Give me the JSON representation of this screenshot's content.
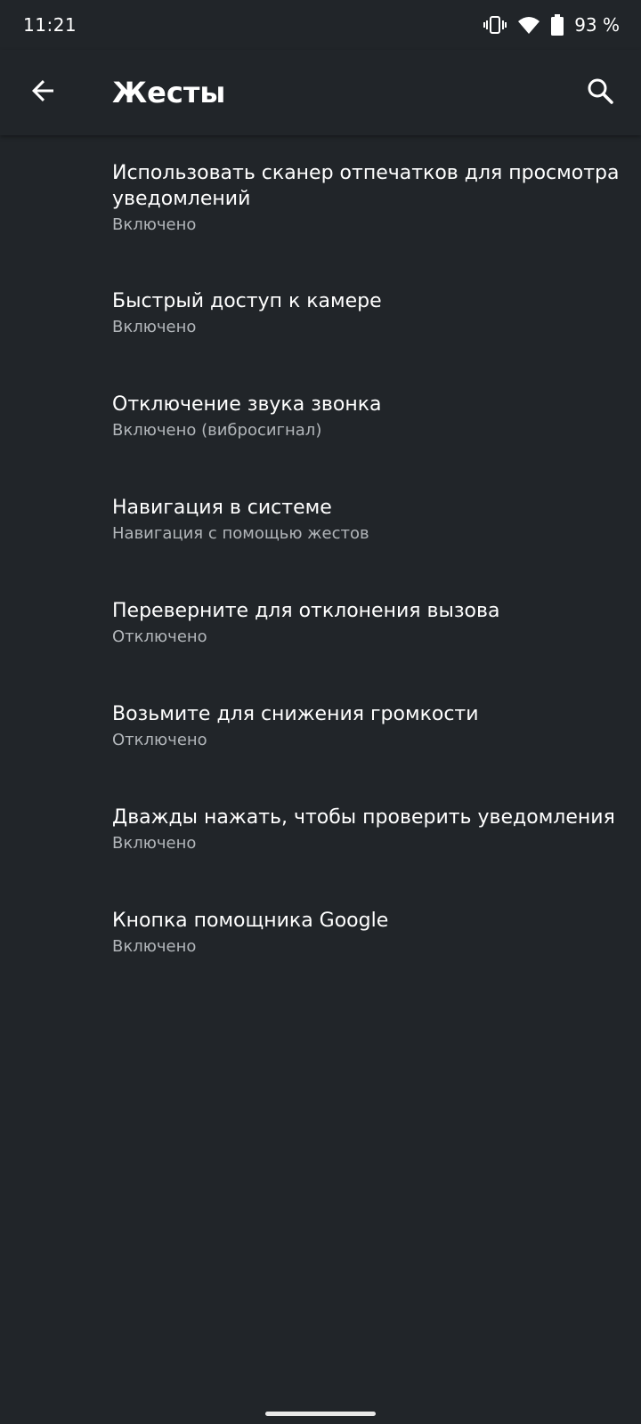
{
  "status_bar": {
    "time": "11:21",
    "battery_percent": "93 %",
    "icons": [
      "vibrate-icon",
      "wifi-icon",
      "battery-icon"
    ]
  },
  "app_bar": {
    "title": "Жесты",
    "back_icon": "arrow-back-icon",
    "search_icon": "search-icon"
  },
  "settings": [
    {
      "title": "Использовать сканер отпечатков для просмотра уведомлений",
      "summary": "Включено"
    },
    {
      "title": "Быстрый доступ к камере",
      "summary": "Включено"
    },
    {
      "title": "Отключение звука звонка",
      "summary": "Включено (вибросигнал)"
    },
    {
      "title": "Навигация в системе",
      "summary": "Навигация с помощью жестов"
    },
    {
      "title": "Переверните для отклонения вызова",
      "summary": "Отключено"
    },
    {
      "title": "Возьмите для снижения громкости",
      "summary": "Отключено"
    },
    {
      "title": "Дважды нажать, чтобы проверить уведомления",
      "summary": "Включено"
    },
    {
      "title": "Кнопка помощника Google",
      "summary": "Включено"
    }
  ],
  "colors": {
    "background": "#212529",
    "text_primary": "#ffffff",
    "text_secondary": "#b2b6ba"
  }
}
